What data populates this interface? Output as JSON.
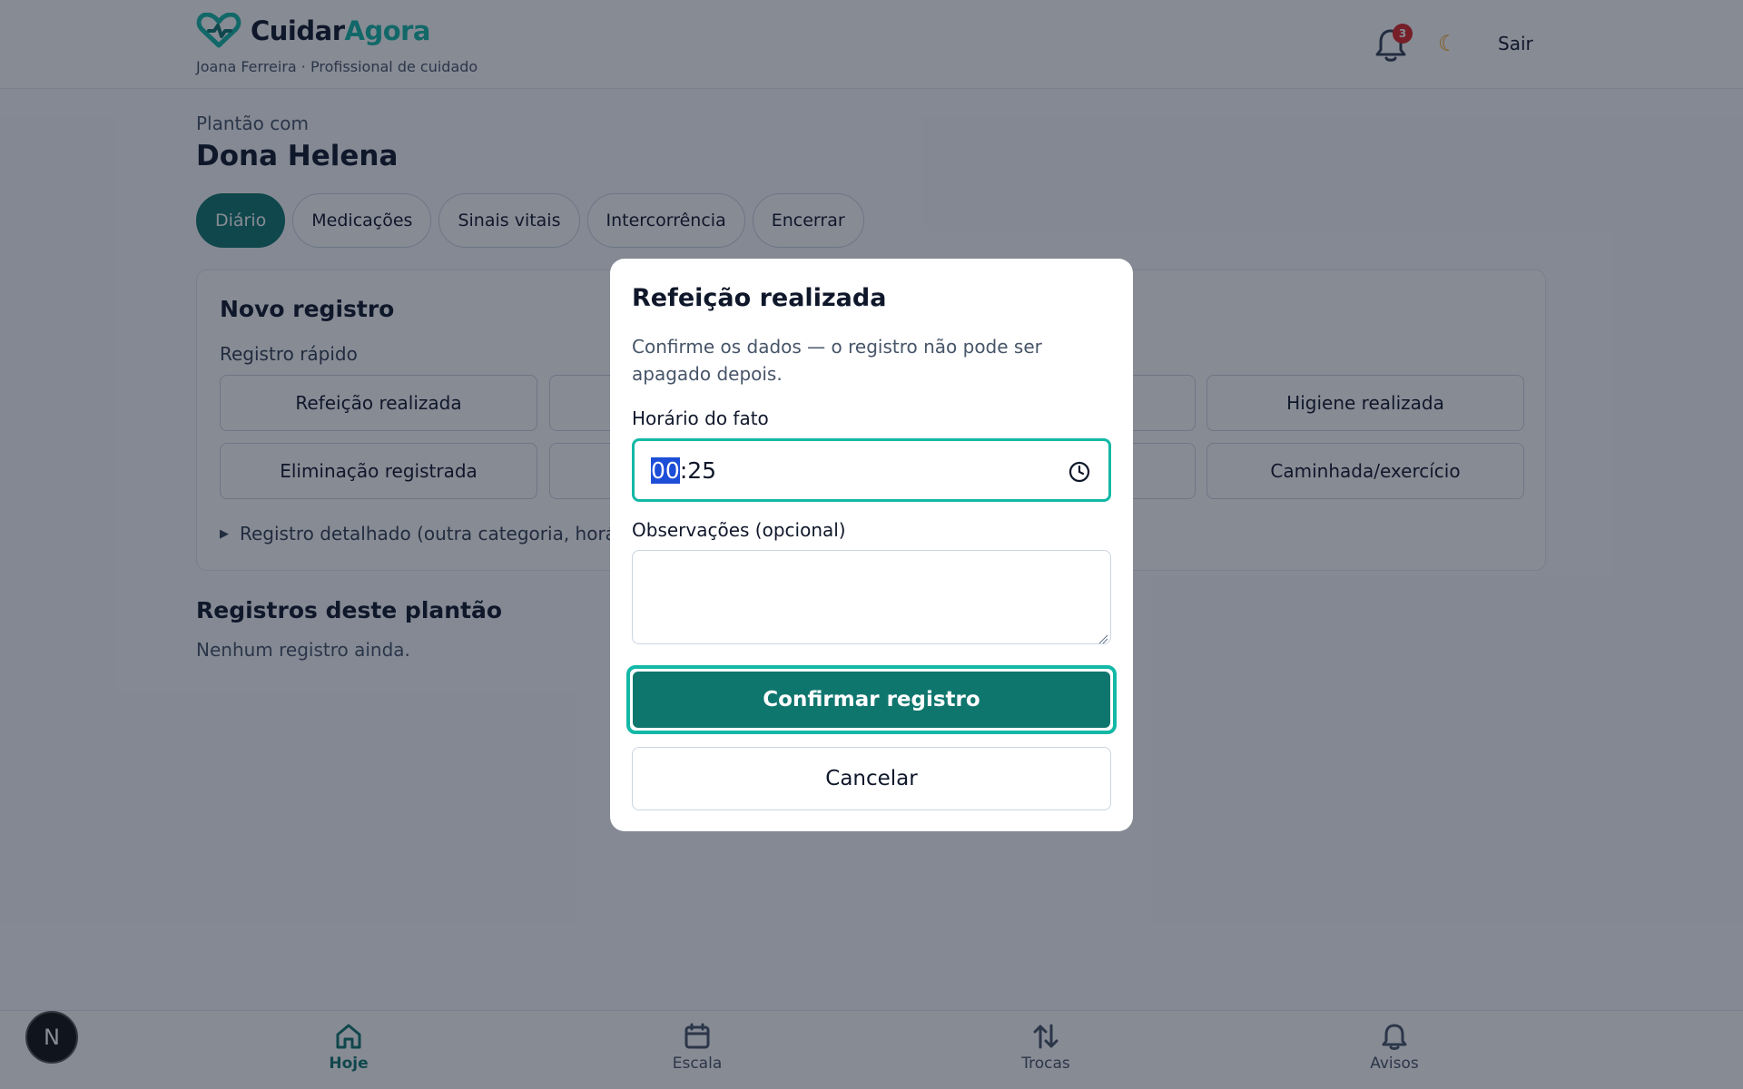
{
  "header": {
    "brand_part1": "Cuidar",
    "brand_part2": "Agora",
    "user_line": "Joana Ferreira · Profissional de cuidado",
    "notifications_count": "3",
    "theme_icon": "moon-icon",
    "logout_label": "Sair"
  },
  "page": {
    "shift_with_label": "Plantão com",
    "patient_name": "Dona Helena",
    "tabs": [
      {
        "label": "Diário",
        "active": true
      },
      {
        "label": "Medicações",
        "active": false
      },
      {
        "label": "Sinais vitais",
        "active": false
      },
      {
        "label": "Intercorrência",
        "active": false
      },
      {
        "label": "Encerrar",
        "active": false
      }
    ]
  },
  "new_record": {
    "title": "Novo registro",
    "quick_label": "Registro rápido",
    "quick_buttons": [
      "Refeição realizada",
      "",
      "",
      "Higiene realizada",
      "Eliminação registrada",
      "",
      "",
      "Caminhada/exercício"
    ],
    "detailed_label": "Registro detalhado (outra categoria, horári"
  },
  "records": {
    "title": "Registros deste plantão",
    "empty": "Nenhum registro ainda."
  },
  "bottom_nav": [
    {
      "label": "Hoje",
      "icon": "home-icon",
      "active": true
    },
    {
      "label": "Escala",
      "icon": "calendar-icon",
      "active": false
    },
    {
      "label": "Trocas",
      "icon": "swap-icon",
      "active": false
    },
    {
      "label": "Avisos",
      "icon": "bell-icon",
      "active": false
    }
  ],
  "dev_badge": "N",
  "modal": {
    "title": "Refeição realizada",
    "description": "Confirme os dados — o registro não pode ser apagado depois.",
    "time_label": "Horário do fato",
    "time_hours": "00",
    "time_sep": ":",
    "time_minutes": "25",
    "notes_label": "Observações (opcional)",
    "notes_value": "",
    "confirm_label": "Confirmar registro",
    "cancel_label": "Cancelar"
  },
  "colors": {
    "primary": "#0f766e",
    "accent": "#14b8a6",
    "badge": "#dc2626"
  }
}
